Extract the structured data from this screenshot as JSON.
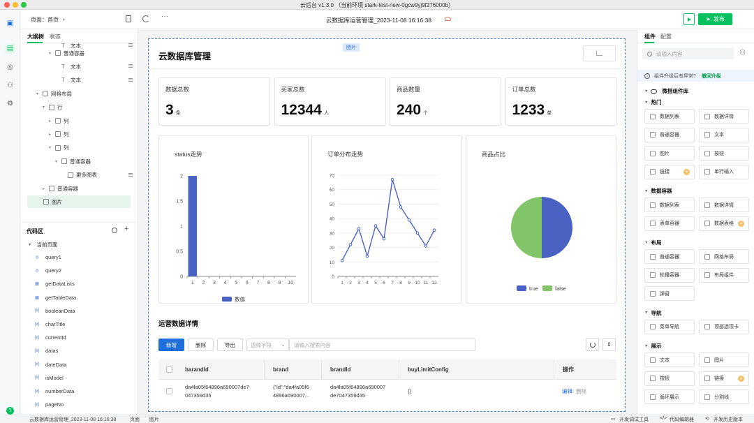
{
  "window": {
    "title": "云后台 v1.3.0 （当前环境 stark-test-new-0gcw9yj9f276000b）"
  },
  "toolbar": {
    "page_label": "页面：首页",
    "doc_title": "云数据库运营管理_2023-11-08 16:16:38",
    "publish_label": "发布"
  },
  "left_panel": {
    "tabs": [
      "大纲树",
      "状态"
    ],
    "tree": [
      {
        "label": "文本",
        "depth": 4,
        "icon": "T",
        "menu": true,
        "partial": true
      },
      {
        "label": "普通容器",
        "depth": 3,
        "icon": "box",
        "caret": "▾"
      },
      {
        "label": "文本",
        "depth": 4,
        "icon": "T",
        "menu": true
      },
      {
        "label": "文本",
        "depth": 4,
        "icon": "T",
        "menu": true
      },
      {
        "label": "网格布局",
        "depth": 1,
        "icon": "grid",
        "caret": "▾"
      },
      {
        "label": "行",
        "depth": 2,
        "icon": "box",
        "caret": "▾"
      },
      {
        "label": "列",
        "depth": 3,
        "icon": "box",
        "caret": "▸"
      },
      {
        "label": "列",
        "depth": 3,
        "icon": "box",
        "caret": "▸"
      },
      {
        "label": "列",
        "depth": 3,
        "icon": "box",
        "caret": "▾"
      },
      {
        "label": "普通容器",
        "depth": 4,
        "icon": "box",
        "caret": "▾"
      },
      {
        "label": "更多图表",
        "depth": 5,
        "icon": "chart",
        "menu": true
      },
      {
        "label": "普通容器",
        "depth": 2,
        "icon": "box",
        "caret": "▸"
      },
      {
        "label": "图片",
        "depth": 1,
        "icon": "img",
        "selected": true
      }
    ],
    "code_title": "代码区",
    "code_root": "当前页面",
    "code_items": [
      {
        "label": "query1",
        "icon": "db"
      },
      {
        "label": "query2",
        "icon": "db"
      },
      {
        "label": "getDataLists",
        "icon": "API"
      },
      {
        "label": "getTableData",
        "icon": "API"
      },
      {
        "label": "booleanData",
        "icon": "{x}"
      },
      {
        "label": "charTitle",
        "icon": "{x}"
      },
      {
        "label": "currentId",
        "icon": "{x}"
      },
      {
        "label": "datas",
        "icon": "{x}"
      },
      {
        "label": "dateData",
        "icon": "{x}"
      },
      {
        "label": "isModel",
        "icon": "{x}"
      },
      {
        "label": "numberData",
        "icon": "{x}"
      },
      {
        "label": "pageNo",
        "icon": "{x}"
      }
    ]
  },
  "canvas": {
    "selection_tag": "图片",
    "page_title": "云数据库管理",
    "stats": [
      {
        "title": "数据总数",
        "value": "3",
        "unit": "条"
      },
      {
        "title": "买家总数",
        "value": "12344",
        "unit": "人"
      },
      {
        "title": "商品数量",
        "value": "240",
        "unit": "个"
      },
      {
        "title": "订单总数",
        "value": "1233",
        "unit": "单"
      }
    ],
    "section_title": "运营数据详情",
    "actions": {
      "add": "新增",
      "delete": "删除",
      "export": "导出",
      "field_placeholder": "选择字段",
      "search_placeholder": "请输入搜索内容"
    },
    "table": {
      "headers": [
        "barandId",
        "brand",
        "brandId",
        "buyLimitConfig",
        "操作"
      ],
      "rows": [
        {
          "cells": [
            "da4fa05f64896a690007de7 047359d35",
            "{\"id\":\"da4fa05f6 4896a690007...",
            "da4fa05f64896a690007 de7047359d35",
            "{}"
          ],
          "edit": "编辑",
          "delete": "删除"
        }
      ]
    }
  },
  "chart_data": [
    {
      "type": "bar",
      "title": "status走势",
      "categories": [
        "1",
        "2",
        "3",
        "4",
        "5",
        "6",
        "7",
        "8",
        "9",
        "10"
      ],
      "series": [
        {
          "name": "数值",
          "values": [
            2,
            0,
            0,
            0,
            0,
            0,
            0,
            0,
            0,
            0
          ]
        }
      ],
      "yticks": [
        "0",
        "0.5",
        "1",
        "1.5",
        "2"
      ],
      "ylim": [
        0,
        2
      ],
      "legend": "bottom",
      "color": "#4a63c2"
    },
    {
      "type": "line",
      "title": "订单分布走势",
      "categories": [
        "1",
        "2",
        "3",
        "4",
        "5",
        "6",
        "7",
        "8",
        "9",
        "10",
        "11",
        "12"
      ],
      "series": [
        {
          "values": [
            11,
            22,
            33,
            14,
            35,
            26,
            67,
            48,
            39,
            30,
            21,
            32
          ]
        }
      ],
      "yticks": [
        "0",
        "10",
        "20",
        "30",
        "40",
        "50",
        "60",
        "70"
      ],
      "ylim": [
        0,
        70
      ],
      "color": "#4a63c2"
    },
    {
      "type": "pie",
      "title": "商品占比",
      "series": [
        {
          "name": "true",
          "value": 50,
          "color": "#4a63c2"
        },
        {
          "name": "false",
          "value": 50,
          "color": "#82c468"
        }
      ],
      "legend": "bottom"
    }
  ],
  "right_panel": {
    "tabs": [
      "组件",
      "配置"
    ],
    "search_placeholder": "请输入内容",
    "notice": "组件升级后有异常?",
    "rollback": "撤回升级",
    "library": "微搭组件库",
    "sections": [
      {
        "title": "热门",
        "items": [
          {
            "label": "数据列表"
          },
          {
            "label": "数据详情"
          },
          {
            "label": "普通容器"
          },
          {
            "label": "文本"
          },
          {
            "label": "图片"
          },
          {
            "label": "按钮"
          },
          {
            "label": "链接",
            "badge": true
          },
          {
            "label": "单行输入"
          }
        ]
      },
      {
        "title": "数据容器",
        "items": [
          {
            "label": "数据列表"
          },
          {
            "label": "数据详情"
          },
          {
            "label": "表单容器"
          },
          {
            "label": "数据表格",
            "badge": true
          }
        ]
      },
      {
        "title": "布局",
        "items": [
          {
            "label": "普通容器"
          },
          {
            "label": "网格布局"
          },
          {
            "label": "轮播容器"
          },
          {
            "label": "布局组件"
          },
          {
            "label": "弹窗"
          }
        ]
      },
      {
        "title": "导航",
        "items": [
          {
            "label": "菜单导航"
          },
          {
            "label": "顶部选项卡"
          }
        ]
      },
      {
        "title": "展示",
        "items": [
          {
            "label": "文本"
          },
          {
            "label": "图片"
          },
          {
            "label": "按钮"
          },
          {
            "label": "链接",
            "badge": true
          },
          {
            "label": "循环展示"
          },
          {
            "label": "分割线"
          }
        ]
      }
    ]
  },
  "statusbar": {
    "crumbs": [
      "云数据库运营管理_2023-11-08 16:16:38",
      "页面",
      "图片"
    ],
    "right": [
      "开发调试工具",
      "代码编辑器",
      "开发历史版本"
    ]
  },
  "colors": {
    "accent": "#1e6fdb",
    "publish": "#07c160",
    "chart_blue": "#4a63c2",
    "chart_green": "#82c468"
  }
}
